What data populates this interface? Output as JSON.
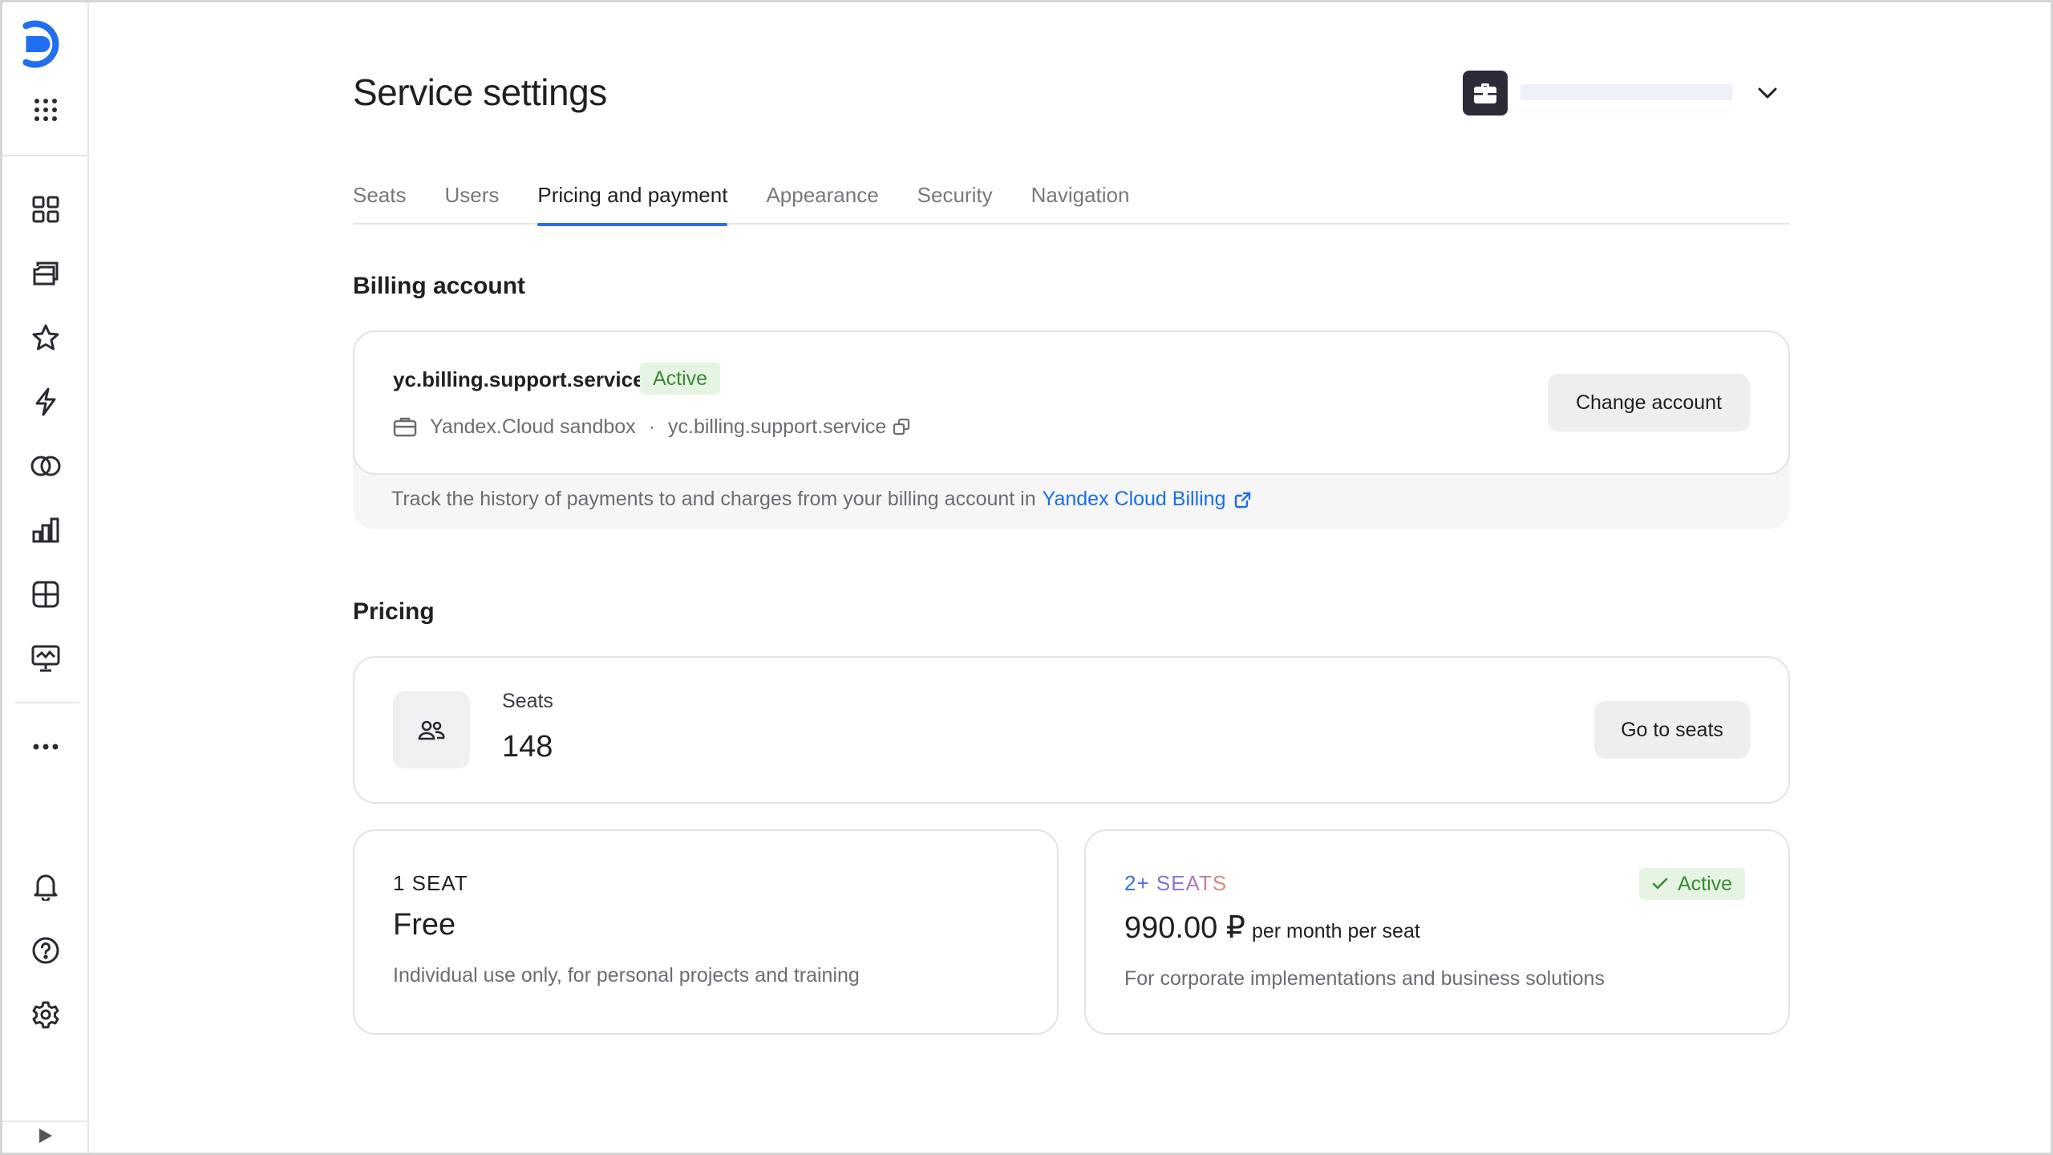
{
  "page": {
    "title": "Service settings"
  },
  "sidebar": {
    "logo_icon": "yandex-logo-icon",
    "top_icons": [
      "apps-grid-icon"
    ],
    "nav_icons": [
      "dashboard-icon",
      "collections-icon",
      "favorites-star-icon",
      "lightning-icon",
      "rings-icon",
      "bar-chart-icon",
      "table-icon",
      "presentation-icon",
      "more-icon"
    ],
    "bottom_icons": [
      "bell-icon",
      "help-icon",
      "gear-icon"
    ],
    "collapse_icon": "play-triangle-icon"
  },
  "tabs": [
    {
      "label": "Seats",
      "active": false
    },
    {
      "label": "Users",
      "active": false
    },
    {
      "label": "Pricing and payment",
      "active": true
    },
    {
      "label": "Appearance",
      "active": false
    },
    {
      "label": "Security",
      "active": false
    },
    {
      "label": "Navigation",
      "active": false
    }
  ],
  "billing": {
    "section_title": "Billing account",
    "account_name": "yc.billing.support.service",
    "status": "Active",
    "cloud_name": "Yandex.Cloud sandbox",
    "separator": "·",
    "account_id": "yc.billing.support.service",
    "change_button": "Change account",
    "note": "Track the history of payments to and charges from your billing account in",
    "note_link": "Yandex Cloud Billing"
  },
  "pricing": {
    "section_title": "Pricing",
    "seats_label": "Seats",
    "seats_value": "148",
    "go_to_seats_button": "Go to seats",
    "plans": [
      {
        "title": "1 SEAT",
        "price": "Free",
        "period": "",
        "description": "Individual use only, for personal projects and training"
      },
      {
        "title": "2+ SEATS",
        "price": "990.00 ₽",
        "period": "per month per seat",
        "description": "For corporate implementations and business solutions",
        "status": "Active"
      }
    ]
  },
  "colors": {
    "accent": "#2e6be6",
    "link": "#1a6ee6",
    "active_badge_bg": "#e5f4e3",
    "active_badge_text": "#3c8a36"
  }
}
